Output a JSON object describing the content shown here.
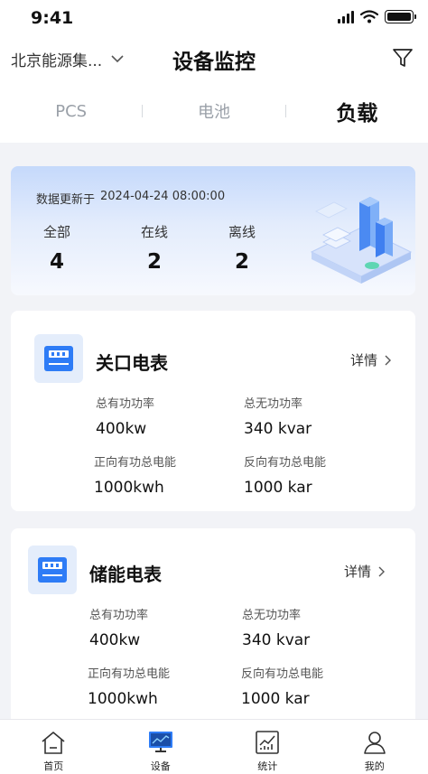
{
  "status_bar": {
    "time": "9:41"
  },
  "header": {
    "company": "北京能源集...",
    "title": "设备监控"
  },
  "tabs": [
    {
      "label": "PCS",
      "active": false
    },
    {
      "label": "电池",
      "active": false
    },
    {
      "label": "负载",
      "active": true
    }
  ],
  "summary": {
    "update_label": "数据更新于",
    "update_time": "2024-04-24 08:00:00",
    "stats": [
      {
        "label": "全部",
        "value": "4"
      },
      {
        "label": "在线",
        "value": "2"
      },
      {
        "label": "离线",
        "value": "2"
      }
    ]
  },
  "devices": [
    {
      "name": "关口电表",
      "detail": "详情",
      "metrics": [
        {
          "label": "总有功功率",
          "value": "400kw"
        },
        {
          "label": "总无功功率",
          "value": "340 kvar"
        },
        {
          "label": "正向有功总电能",
          "value": "1000kwh"
        },
        {
          "label": "反向有功总电能",
          "value": "1000 kar"
        }
      ]
    },
    {
      "name": "储能电表",
      "detail": "详情",
      "metrics": [
        {
          "label": "总有功功率",
          "value": "400kw"
        },
        {
          "label": "总无功功率",
          "value": "340 kvar"
        },
        {
          "label": "正向有功总电能",
          "value": "1000kwh"
        },
        {
          "label": "反向有功总电能",
          "value": "1000 kar"
        }
      ]
    }
  ],
  "bottom_nav": [
    {
      "label": "首页",
      "icon": "home-icon",
      "active": false
    },
    {
      "label": "设备",
      "icon": "monitor-icon",
      "active": true
    },
    {
      "label": "统计",
      "icon": "chart-icon",
      "active": false
    },
    {
      "label": "我的",
      "icon": "user-icon",
      "active": false
    }
  ],
  "colors": {
    "accent": "#2e7cf6",
    "icon_bg": "#e4edfb",
    "page_bg": "#f2f3f7"
  }
}
